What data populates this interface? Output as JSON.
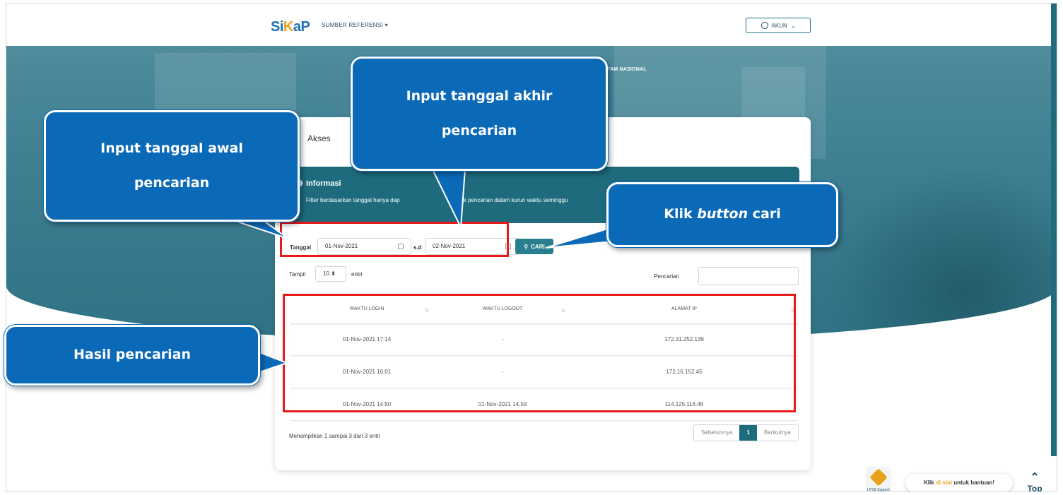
{
  "navbar": {
    "logo_si": "Si",
    "logo_k": "K",
    "logo_ap": "aP",
    "menu_ref": "SUMBER REFERENSI",
    "akun": "AKUN"
  },
  "hero": {
    "text": "ITAM NASIONAL"
  },
  "card": {
    "title": "Akses",
    "info_title": "Informasi",
    "info_text": "Filter berdasarkan tanggal hanya dap",
    "info_text_b": "n untuk pencarian dalam kurun waktu seminggu"
  },
  "filter": {
    "label_tanggal": "Tanggal",
    "start_date": "01-Nov-2021",
    "label_sd": "s.d",
    "end_date": "02-Nov-2021",
    "button_cari": "CARI"
  },
  "length": {
    "label_tampil": "Tampil",
    "value": "10",
    "label_entri": "entri"
  },
  "search": {
    "label": "Pencarian",
    "value": ""
  },
  "table": {
    "headers": [
      "WAKTU LOGIN",
      "WAKTU LOGOUT",
      "ALAMAT IP"
    ],
    "rows": [
      [
        "01-Nov-2021 17:14",
        "-",
        "172.31.252.139"
      ],
      [
        "01-Nov-2021 16:01",
        "-",
        "172.16.152.45"
      ],
      [
        "01-Nov-2021 14:50",
        "01-Nov-2021 14:59",
        "114.125.116.46"
      ]
    ]
  },
  "footer": {
    "info": "Menampilkan 1 sampai 3 dari 3 entri",
    "prev": "Sebelumnya",
    "page": "1",
    "next": "Berikutnya"
  },
  "callouts": {
    "awal_line1": "Input tanggal awal",
    "awal_line2": "pencarian",
    "akhir_line1": "Input tanggal akhir",
    "akhir_line2": "pencarian",
    "cari_a": "Klik ",
    "cari_b": "button",
    "cari_c": " cari",
    "hasil": "Hasil pencarian"
  },
  "widgets": {
    "lpse": "LPSE Support",
    "help_a": "Klik ",
    "help_b": "di sini",
    "help_c": " untuk bantuan!",
    "top": "Top"
  },
  "colors": {
    "primary": "#1e6b7d",
    "callout": "#0b6ab8",
    "highlight": "#e8191b",
    "accent": "#e8a21c"
  }
}
